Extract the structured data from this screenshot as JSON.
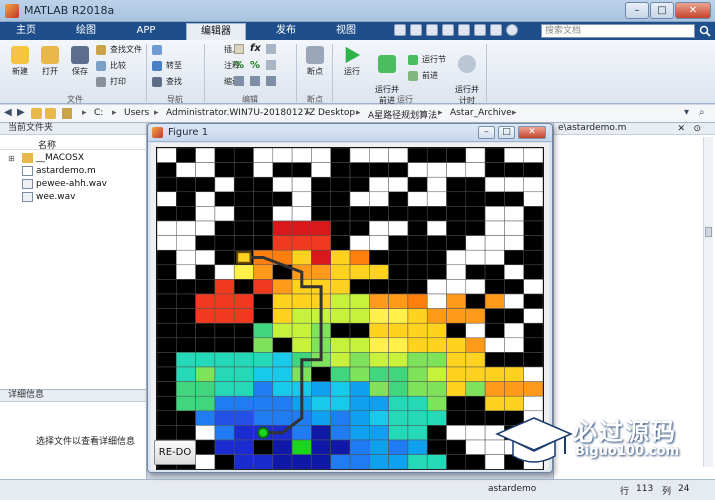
{
  "window": {
    "title": "MATLAB R2018a",
    "min": "–",
    "max": "□",
    "close": "✕"
  },
  "tabs": [
    "主页",
    "绘图",
    "APP",
    "编辑器",
    "发布",
    "视图"
  ],
  "search": {
    "placeholder": "搜索文档"
  },
  "ribbon": {
    "file_group": {
      "label": "文件",
      "new": "新建",
      "open": "打开",
      "save": "保存",
      "find_files": "查找文件",
      "compare": "比较",
      "print": "打印"
    },
    "nav_group": {
      "label": "导航",
      "goto": "转至",
      "find": "查找"
    },
    "edit_group": {
      "label": "编辑",
      "insert": "插入",
      "comment": "注释",
      "indent": "缩进"
    },
    "breakpoint_group": {
      "label": "断点",
      "breakpoints": "断点"
    },
    "run_group": {
      "label": "运行",
      "run": "运行",
      "run_advance": "运行并\n前进",
      "run_section": "运行节",
      "advance": "前进",
      "run_time": "运行并\n计时"
    }
  },
  "address": {
    "parts": [
      "C:",
      "Users",
      "Administrator.WIN7U-20180127Z",
      "Desktop",
      "A星路径规划算法",
      "Astar_Archive"
    ]
  },
  "current_folder": {
    "title": "当前文件夹",
    "column": "名称",
    "items": [
      "__MACOSX",
      "astardemo.m",
      "pewee-ahh.wav",
      "wee.wav"
    ]
  },
  "details": {
    "title": "详细信息",
    "hint": "选择文件以查看详细信息"
  },
  "editor": {
    "path": "e\\astardemo.m"
  },
  "figure": {
    "title": "Figure 1",
    "redo_label": "RE-DO"
  },
  "status": {
    "file": "astardemo",
    "row_label": "行",
    "row": "113",
    "col_label": "列",
    "col": "24"
  },
  "watermark": {
    "text": "必过源码",
    "url": "Biguo100.com"
  },
  "grid": {
    "cols": 20,
    "rows": 16,
    "cell_colors": {
      "b": "#000000",
      "w": "#ffffff",
      "R": "#d7191c",
      "r": "#ef3a1f",
      "o": "#ff7f0e",
      "O": "#ff9a1a",
      "y": "#ffd21f",
      "Y": "#fff04a",
      "l": "#c6f23c",
      "g": "#7ee35a",
      "G": "#3fd67d",
      "t": "#25d8b8",
      "c": "#19c9ea",
      "C": "#0fa0ef",
      "k": "#1f7cf2",
      "u": "#2450e6",
      "U": "#1a2bd0",
      "N": "#1018a8",
      "S": "#1bd61b"
    },
    "cells": [
      "wbwbbwwwwbwwwbbbwbww",
      "bwwbbwbbwbbbbwwwwbbb",
      "bbbwbbwwbbbwwbwbbwww",
      "wbwbbbbwbbwwbwwbbbbw",
      "bbwwbbwwbbbbbbbbbwwb",
      "wwwbbbRRRbbwwbwbbwwb",
      "wwbbbbrrrbwwbbbbwwwb",
      "bwwbbooyRyobbbbwwwbb",
      "bwbwYObOOyyybbbwbbwb",
      "bbbrbrOyyybbbbwwwbbw",
      "bbrrrbyyyllOOowObOwb",
      "bbrrrbyllllYYyOOObbw",
      "bbbbbGllgbbyyyybwbwb",
      "bbbbbgblgllYYyyyOwwb",
      "btttttcGglgllggyybbb",
      "btgttccgbGgGGglyyyyw",
      "bGGttkccCcCgGggygOOO",
      "bGGkkkkCccCCttgbbyyw",
      "bbkuukkkCkCctttbbbbw",
      "bbwkUUUkNkCCttbwwwbb",
      "bbbUUbNSNNkCkCbbwwwb",
      "bbwbUUNNNkkCCttbbwbw"
    ],
    "path": [
      [
        4,
        7
      ],
      [
        5,
        7
      ],
      [
        7,
        8
      ],
      [
        7,
        9
      ],
      [
        8,
        9
      ],
      [
        8,
        10
      ],
      [
        8,
        11
      ],
      [
        8,
        13
      ],
      [
        8,
        14
      ],
      [
        7,
        14
      ],
      [
        7,
        16
      ],
      [
        7,
        18
      ],
      [
        6,
        19
      ],
      [
        5,
        19
      ]
    ]
  }
}
